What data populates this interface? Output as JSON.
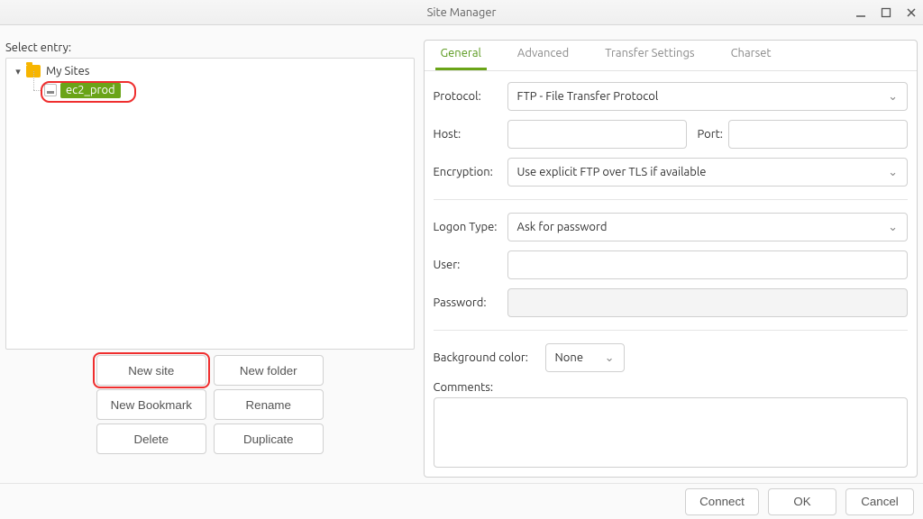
{
  "window": {
    "title": "Site Manager"
  },
  "left": {
    "select_entry_label": "Select entry:",
    "root_label": "My Sites",
    "site_name": "ec2_prod",
    "buttons": {
      "new_site": "New site",
      "new_folder": "New folder",
      "new_bookmark": "New Bookmark",
      "rename": "Rename",
      "delete": "Delete",
      "duplicate": "Duplicate"
    }
  },
  "tabs": {
    "general": "General",
    "advanced": "Advanced",
    "transfer": "Transfer Settings",
    "charset": "Charset"
  },
  "form": {
    "protocol_label": "Protocol:",
    "protocol_value": "FTP - File Transfer Protocol",
    "host_label": "Host:",
    "host_value": "",
    "port_label": "Port:",
    "port_value": "",
    "encryption_label": "Encryption:",
    "encryption_value": "Use explicit FTP over TLS if available",
    "logon_label": "Logon Type:",
    "logon_value": "Ask for password",
    "user_label": "User:",
    "user_value": "",
    "password_label": "Password:",
    "password_value": "",
    "bgcolor_label": "Background color:",
    "bgcolor_value": "None",
    "comments_label": "Comments:",
    "comments_value": ""
  },
  "footer": {
    "connect": "Connect",
    "ok": "OK",
    "cancel": "Cancel"
  }
}
